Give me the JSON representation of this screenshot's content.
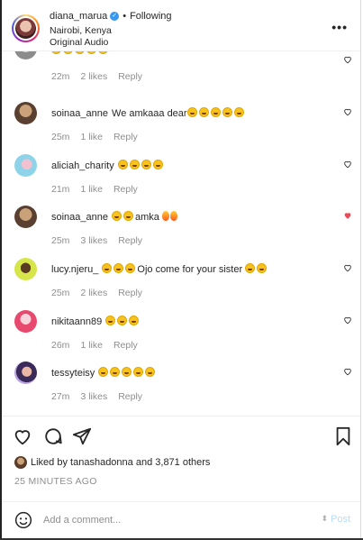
{
  "header": {
    "username": "diana_marua",
    "follow_status": "Following",
    "location": "Nairobi, Kenya",
    "audio": "Original Audio",
    "more_glyph": "•••"
  },
  "comments": [
    {
      "username": "",
      "text": "",
      "time": "22m",
      "likes": "2 likes",
      "reply": "Reply",
      "liked": false,
      "emoji_count": 0
    },
    {
      "username": "soinaa_anne",
      "text": "We amkaaa dear",
      "time": "25m",
      "likes": "1 like",
      "reply": "Reply",
      "liked": false,
      "emoji_count": 5
    },
    {
      "username": "aliciah_charity",
      "text": "",
      "time": "21m",
      "likes": "1 like",
      "reply": "Reply",
      "liked": false,
      "emoji_count": 4
    },
    {
      "username": "soinaa_anne",
      "text": "amka",
      "time": "25m",
      "likes": "3 likes",
      "reply": "Reply",
      "liked": true,
      "emoji_count": 2
    },
    {
      "username": "lucy.njeru_",
      "text": "Ojo come for your sister",
      "time": "25m",
      "likes": "2 likes",
      "reply": "Reply",
      "liked": false,
      "emoji_count": 5
    },
    {
      "username": "nikitaann89",
      "text": "",
      "time": "26m",
      "likes": "1 like",
      "reply": "Reply",
      "liked": false,
      "emoji_count": 3
    },
    {
      "username": "tessyteisy",
      "text": "",
      "time": "27m",
      "likes": "3 likes",
      "reply": "Reply",
      "liked": false,
      "emoji_count": 5
    }
  ],
  "likes_summary": {
    "prefix": "Liked by",
    "user": "tanashadonna",
    "middle": "and",
    "others": "3,871 others"
  },
  "posted_time": "25 MINUTES AGO",
  "comment_input": {
    "placeholder": "Add a comment...",
    "post_label": "Post"
  },
  "colors": {
    "accent": "#0095f6",
    "liked_heart": "#ed4956",
    "muted_text": "#8e8e8e",
    "post_disabled": "#b2dffc"
  },
  "icons": {
    "header": [
      "verified-badge-icon",
      "more-options-icon"
    ],
    "actions": [
      "heart-icon",
      "comment-icon",
      "share-icon",
      "bookmark-icon"
    ],
    "input": [
      "emoji-icon"
    ]
  }
}
